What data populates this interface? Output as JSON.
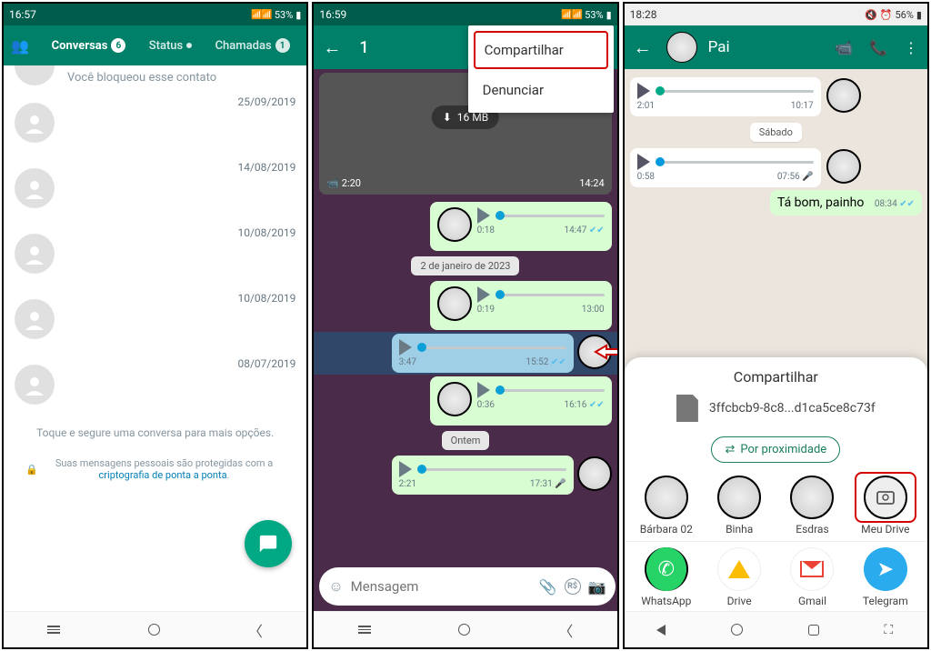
{
  "panel1": {
    "status": {
      "time": "16:57",
      "battery": "53%",
      "icons": "⬙ ⬙ M ···"
    },
    "tabs": {
      "conversas": "Conversas",
      "conversas_badge": "6",
      "status": "Status",
      "chamadas": "Chamadas",
      "chamadas_badge": "1"
    },
    "blocked_text": "Você bloqueou esse contato",
    "dates": [
      "25/09/2019",
      "14/08/2019",
      "10/08/2019",
      "10/08/2019",
      "08/07/2019"
    ],
    "hold_text": "Toque e segure uma conversa para mais opções.",
    "enc_text_1": "Suas mensagens pessoais são protegidas com a ",
    "enc_link": "criptografia de ponta a ponta",
    "enc_text_2": "."
  },
  "panel2": {
    "status": {
      "time": "16:59",
      "battery": "53%"
    },
    "header_count": "1",
    "menu": {
      "share": "Compartilhar",
      "report": "Denunciar"
    },
    "video": {
      "size": "16 MB",
      "duration": "2:20",
      "time": "14:24"
    },
    "msgs": [
      {
        "dur": "0:18",
        "time": "14:47",
        "ticks": true,
        "out": true
      },
      {
        "pill": "2 de janeiro de 2023"
      },
      {
        "dur": "0:19",
        "time": "13:00",
        "out": true
      },
      {
        "dur": "3:47",
        "time": "15:52",
        "ticks": true,
        "out": true,
        "selected": true,
        "arrow": true
      },
      {
        "dur": "0:36",
        "time": "16:16",
        "ticks": true,
        "out": true
      },
      {
        "pill": "Ontem"
      },
      {
        "dur": "2:21",
        "time": "17:31",
        "out": true,
        "mic": true
      }
    ],
    "input_placeholder": "Mensagem"
  },
  "panel3": {
    "status": {
      "time": "18:28",
      "battery": "56%"
    },
    "contact_name": "Pai",
    "voice_msgs": [
      {
        "dur": "2:01",
        "time": "10:17"
      },
      {
        "pill": "Sábado"
      },
      {
        "dur": "0:58",
        "time": "07:56"
      }
    ],
    "text_msg": {
      "text": "Tá bom, painho",
      "time": "08:34"
    },
    "share": {
      "title": "Compartilhar",
      "filename": "3ffcbcb9-8c8...d1ca5ce8c73f",
      "proximity": "Por proximidade",
      "targets_row1": [
        "Bárbara 02",
        "Binha",
        "Esdras",
        "Meu Drive"
      ],
      "targets_row2": [
        "WhatsApp",
        "Drive",
        "Gmail",
        "Telegram"
      ]
    }
  }
}
